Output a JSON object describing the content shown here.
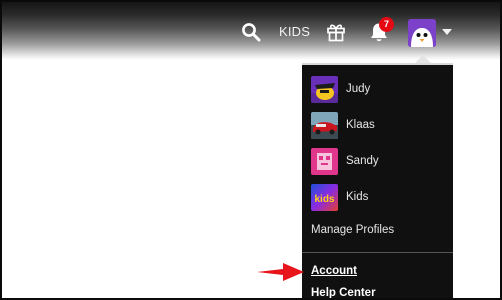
{
  "header": {
    "kids_label": "KIDS",
    "notification_count": "7"
  },
  "profile_menu": {
    "profiles": [
      {
        "name": "Judy",
        "icon": "judy-avatar"
      },
      {
        "name": "Klaas",
        "icon": "klaas-avatar"
      },
      {
        "name": "Sandy",
        "icon": "sandy-avatar"
      },
      {
        "name": "Kids",
        "icon": "kids-avatar",
        "icon_text": "kids"
      }
    ],
    "manage_label": "Manage Profiles",
    "account_label": "Account",
    "help_label": "Help Center"
  },
  "colors": {
    "badge": "#e50914",
    "annotation_arrow": "#e8141c",
    "menu_bg": "#080808",
    "avatar_purple": "#7b41c9"
  }
}
